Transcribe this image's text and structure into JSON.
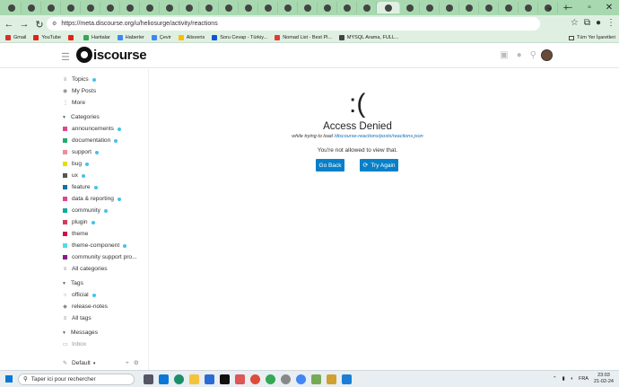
{
  "browser": {
    "tab_count": 28,
    "active_tab_index": 19,
    "url": "https://meta.discourse.org/u/heliosurge/activity/reactions",
    "bookmarks": [
      {
        "label": "Gmail",
        "color": "#d93025"
      },
      {
        "label": "YouTube",
        "color": "#e62117"
      },
      {
        "label": "",
        "color": "#e62117"
      },
      {
        "label": "Haritalar",
        "color": "#34a853"
      },
      {
        "label": "Haberler",
        "color": "#4285f4"
      },
      {
        "label": "Çevir",
        "color": "#4285f4"
      },
      {
        "label": "Alisveris",
        "color": "#fbbc04"
      },
      {
        "label": "Soru Cevap - Türkiy...",
        "color": "#0b57d0"
      },
      {
        "label": "Nomad List - Best Pl...",
        "color": "#e53935"
      },
      {
        "label": "MYSQL Arama, FULL...",
        "color": "#444444"
      }
    ],
    "bookmarks_right": "Tüm Yer İşaretleri"
  },
  "header": {
    "logo_text": "iscourse"
  },
  "sidebar": {
    "top_links": [
      {
        "label": "Topics",
        "icon": "layers-icon",
        "dot": true
      },
      {
        "label": "My Posts",
        "icon": "user-icon",
        "dot": false
      },
      {
        "label": "More",
        "icon": "more-icon",
        "dot": false
      }
    ],
    "categories_title": "Categories",
    "categories": [
      {
        "label": "announcements",
        "color": "#e0468c",
        "dot": true
      },
      {
        "label": "documentation",
        "color": "#25aa6b",
        "dot": true
      },
      {
        "label": "support",
        "color": "#ee8d92",
        "dot": true
      },
      {
        "label": "bug",
        "color": "#e9dd00",
        "dot": true
      },
      {
        "label": "ux",
        "color": "#555555",
        "dot": true
      },
      {
        "label": "feature",
        "color": "#0b73a8",
        "dot": true
      },
      {
        "label": "data & reporting",
        "color": "#e0468c",
        "dot": true
      },
      {
        "label": "community",
        "color": "#12a89d",
        "dot": true
      },
      {
        "label": "plugin",
        "color": "#d23c5a",
        "dot": true
      },
      {
        "label": "theme",
        "color": "#d0104c",
        "dot": false
      },
      {
        "label": "theme-component",
        "color": "#4be0e8",
        "dot": true
      },
      {
        "label": "community support pro...",
        "color": "#8b1a8b",
        "dot": false
      }
    ],
    "all_categories": "All categories",
    "tags_title": "Tags",
    "tags": [
      {
        "label": "official",
        "dot": true
      },
      {
        "label": "release-notes",
        "dot": false
      }
    ],
    "all_tags": "All tags",
    "messages_title": "Messages",
    "inbox": "Inbox",
    "footer_label": "Default"
  },
  "main": {
    "frown": ":(",
    "title": "Access Denied",
    "subtitle_prefix": "while trying to load",
    "subtitle_path": "/discourse-reactions/posts/reactions.json",
    "message": "You're not allowed to view that.",
    "go_back": "Go Back",
    "try_again": "Try Again"
  },
  "taskbar": {
    "search_placeholder": "Taper ici pour rechercher",
    "language": "FRA",
    "time": "23:03",
    "date": "21-02-24"
  }
}
